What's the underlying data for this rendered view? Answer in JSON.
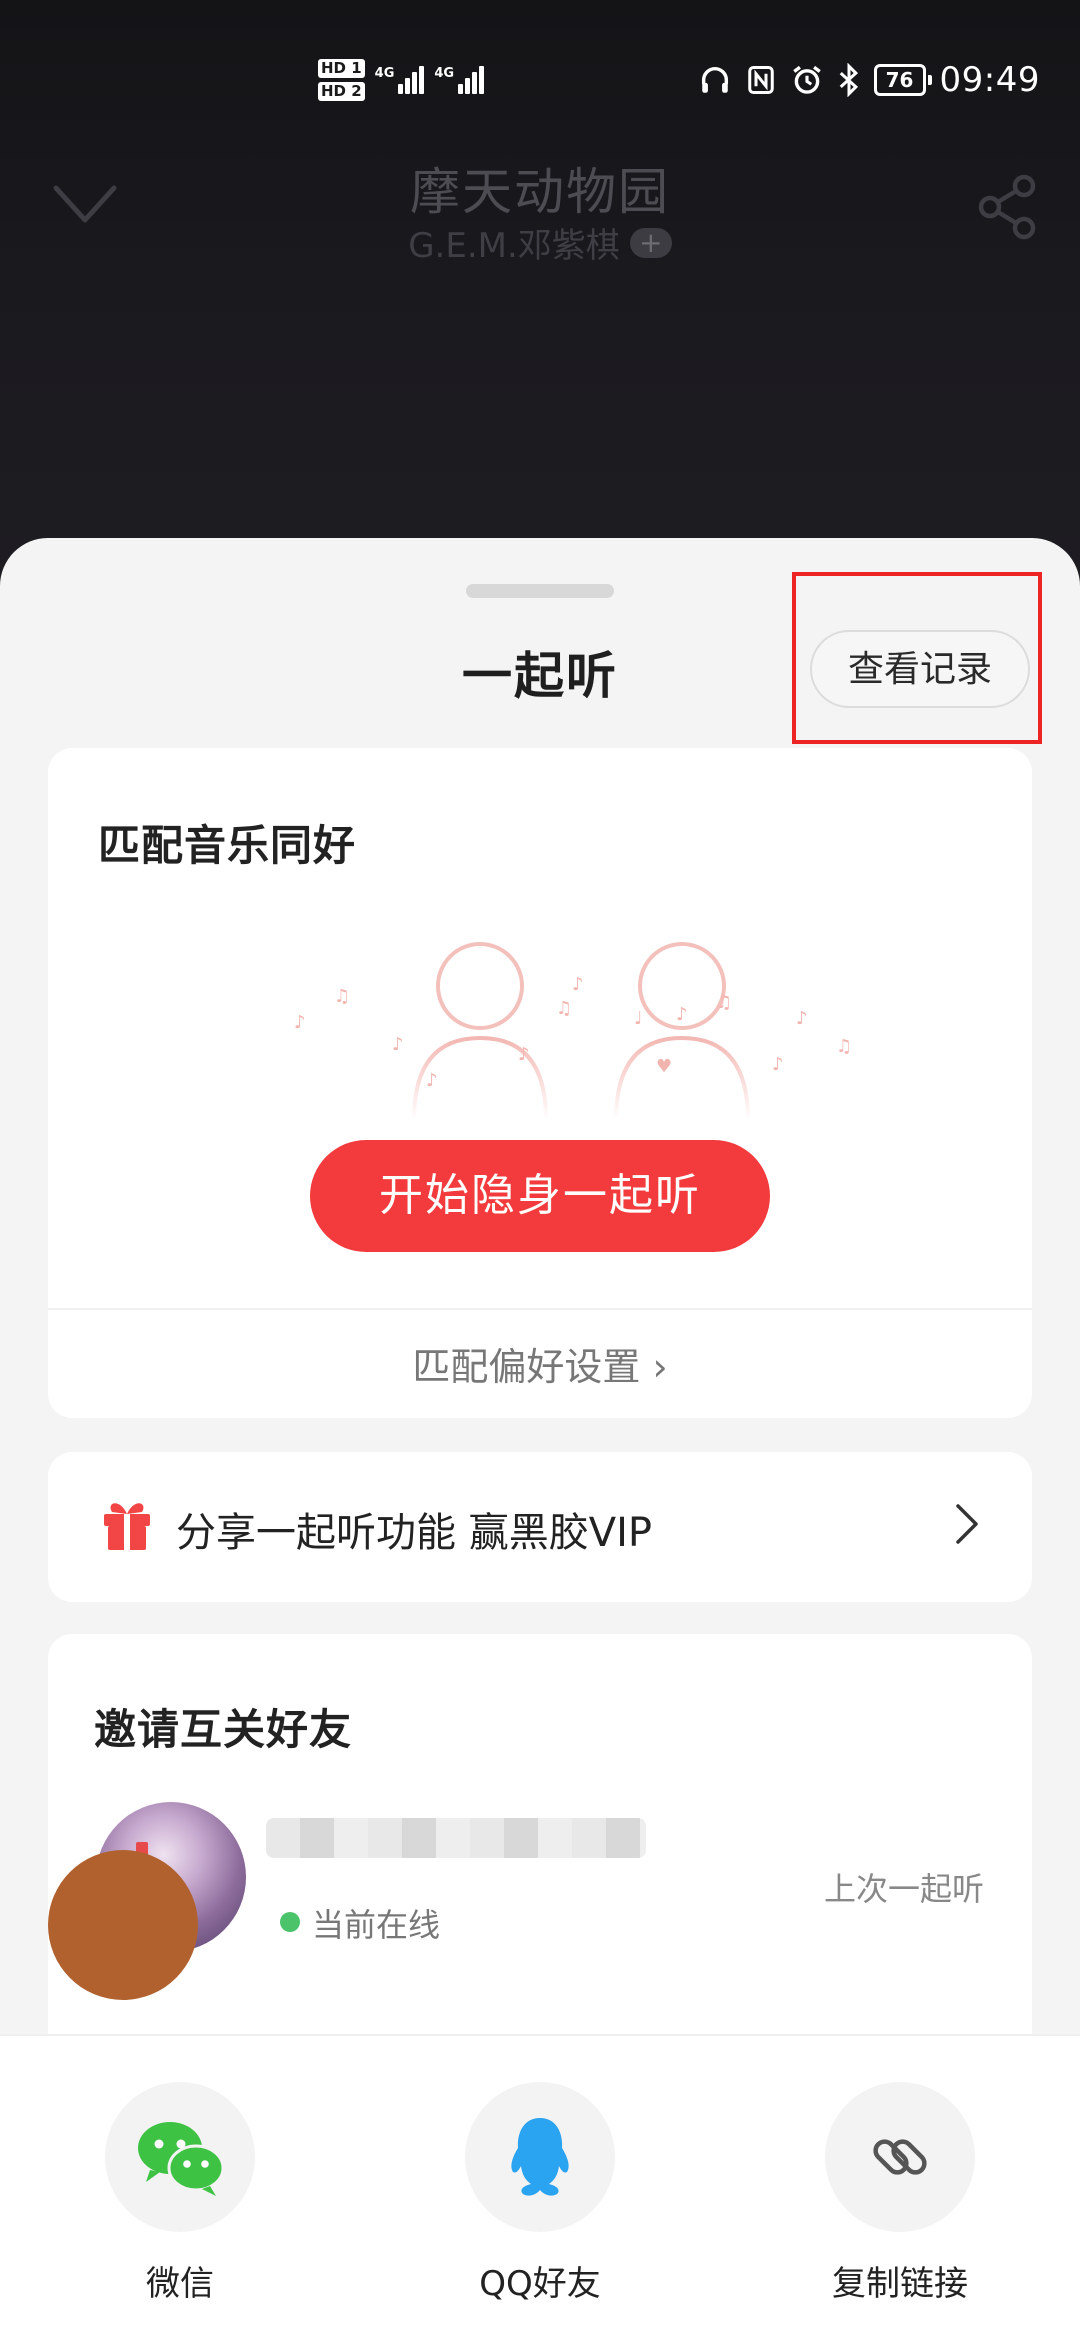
{
  "status_bar": {
    "hd1": "HD 1",
    "hd2": "HD 2",
    "net1": "4G",
    "net2": "4G",
    "battery": "76",
    "time": "09:49"
  },
  "player": {
    "song_title": "摩天动物园",
    "artist": "G.E.M.邓紫棋",
    "follow_symbol": "+"
  },
  "sheet": {
    "title": "一起听",
    "history_button": "查看记录",
    "highlight_color": "#ec2424"
  },
  "match_card": {
    "title": "匹配音乐同好",
    "start_button": "开始隐身一起听",
    "preference_link": "匹配偏好设置 ›"
  },
  "share_card": {
    "text": "分享一起听功能 赢黑胶VIP"
  },
  "invite_card": {
    "title": "邀请互关好友",
    "friends": [
      {
        "status": "当前在线",
        "last": "上次一起听"
      }
    ]
  },
  "share_bar": {
    "options": [
      {
        "label": "微信",
        "icon": "wechat-icon"
      },
      {
        "label": "QQ好友",
        "icon": "qq-icon"
      },
      {
        "label": "复制链接",
        "icon": "link-icon"
      }
    ]
  },
  "colors": {
    "accent": "#f33b3d",
    "online": "#4bc36a",
    "wechat": "#3ec244",
    "qq": "#2aa3f0"
  }
}
